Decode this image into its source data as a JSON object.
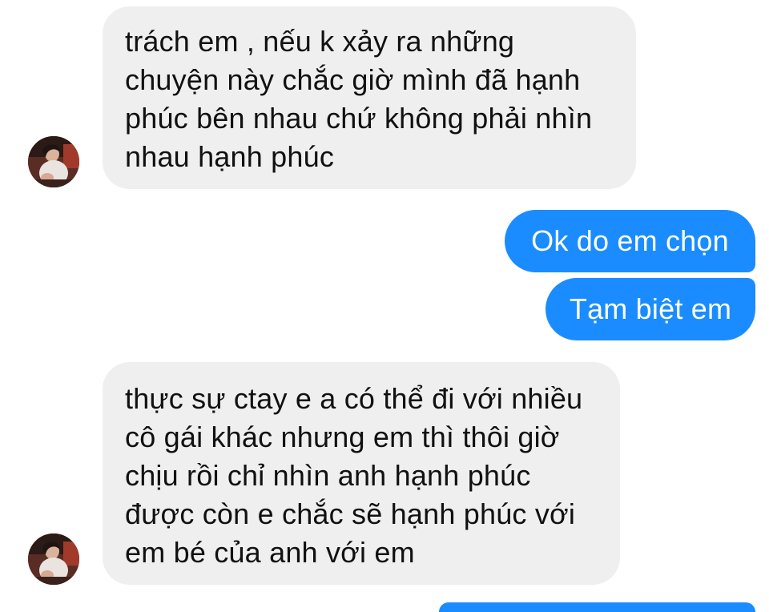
{
  "conversation": {
    "messages": [
      {
        "direction": "incoming",
        "lines": [
          "trách em , nếu k xảy ra những",
          "chuyện này chắc giờ mình đã hạnh",
          "phúc bên nhau chứ không phải nhìn",
          "nhau hạnh phúc"
        ]
      },
      {
        "direction": "outgoing",
        "text": "Ok do em chọn"
      },
      {
        "direction": "outgoing",
        "text": "Tạm biệt em"
      },
      {
        "direction": "incoming",
        "lines": [
          "thực sự ctay e a có thể đi với nhiều",
          "cô gái khác nhưng em thì thôi giờ",
          "chịu rồi chỉ nhìn anh hạnh phúc",
          "được còn e chắc sẽ hạnh phúc với",
          "em bé của anh với em"
        ]
      }
    ]
  },
  "colors": {
    "incoming_bubble": "#efefef",
    "outgoing_bubble": "#1a8cff",
    "outgoing_text": "#ffffff",
    "incoming_text": "#111111"
  },
  "icons": {
    "avatar": "contact-avatar-photo"
  }
}
